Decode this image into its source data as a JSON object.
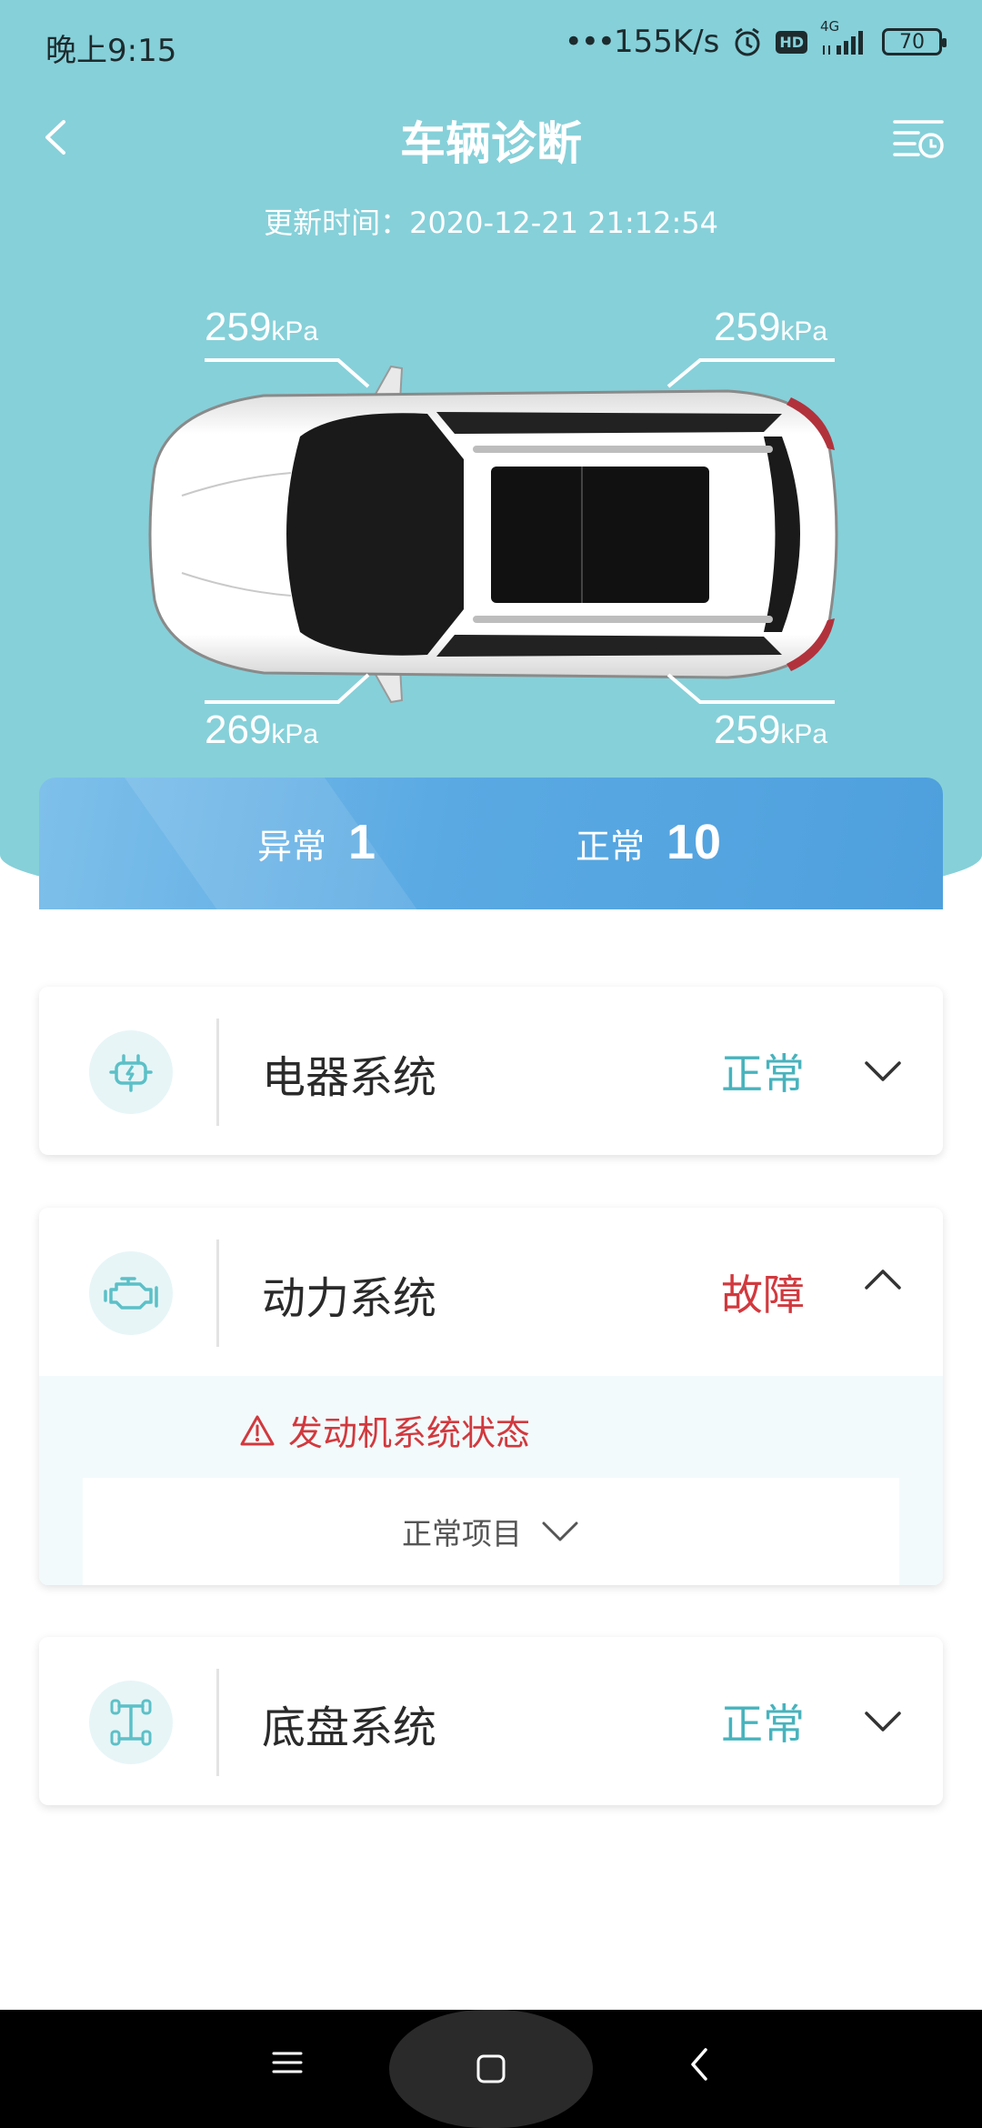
{
  "status_bar": {
    "time": "晚上9:15",
    "network_speed": "155K/s",
    "hd_label": "HD",
    "network_type": "4G",
    "battery": "70"
  },
  "header": {
    "title": "车辆诊断",
    "update_label": "更新时间：",
    "update_time": "2020-12-21 21:12:54"
  },
  "tires": {
    "unit": "kPa",
    "front_left": "259",
    "front_right": "259",
    "rear_left": "269",
    "rear_right": "259"
  },
  "summary": {
    "abnormal_label": "异常",
    "abnormal_count": "1",
    "normal_label": "正常",
    "normal_count": "10"
  },
  "systems": [
    {
      "name": "电器系统",
      "status": "正常",
      "icon": "battery-plug-icon",
      "expanded": false
    },
    {
      "name": "动力系统",
      "status": "故障",
      "icon": "engine-icon",
      "expanded": true,
      "fault_item": "发动机系统状态",
      "normal_items_label": "正常项目"
    },
    {
      "name": "底盘系统",
      "status": "正常",
      "icon": "chassis-icon",
      "expanded": false
    }
  ],
  "colors": {
    "header_teal": "#86d0d9",
    "ok": "#47b3bd",
    "fault": "#d1393e",
    "summary_blue": "#5aa9e3"
  }
}
